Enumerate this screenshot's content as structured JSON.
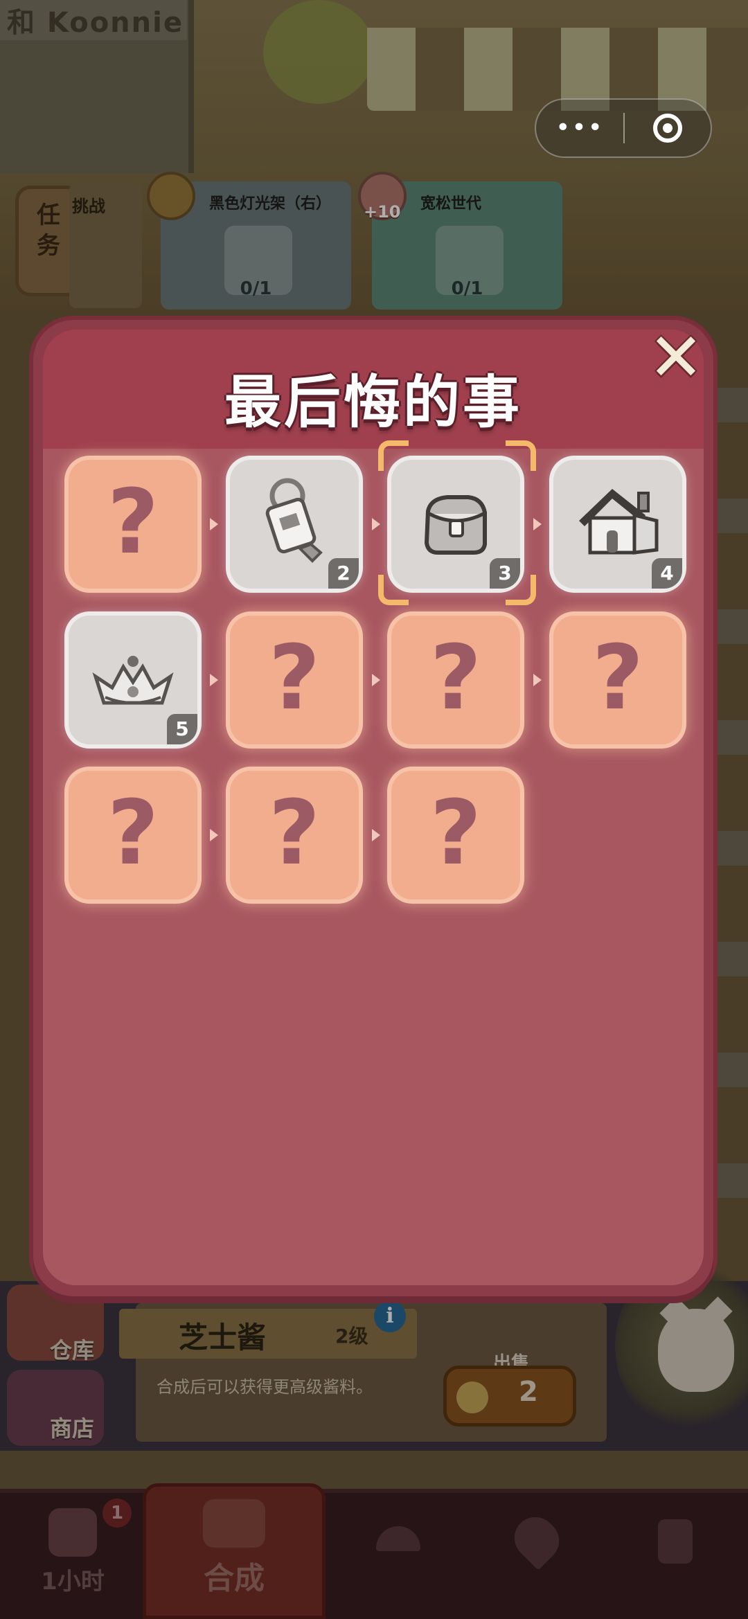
{
  "background": {
    "shop_sign": "和 Koonnie",
    "task_button": "任\n务",
    "challenge_label": "挑战",
    "orders": [
      {
        "title": "黑色灯光架（右）",
        "count": "0/1",
        "icon": "hammer-icon"
      },
      {
        "title": "宽松世代",
        "count": "0/1",
        "bonus": "+10",
        "icon": "shirt-icon"
      }
    ]
  },
  "modal": {
    "title": "最后悔的事",
    "close_glyph": "✕",
    "slots": [
      {
        "state": "unknown",
        "glyph": "?"
      },
      {
        "state": "known",
        "icon": "tag-icon",
        "level": "2"
      },
      {
        "state": "known",
        "icon": "bag-icon",
        "level": "3",
        "selected": true
      },
      {
        "state": "known",
        "icon": "house-icon",
        "level": "4"
      },
      {
        "state": "known",
        "icon": "crown-icon",
        "level": "5"
      },
      {
        "state": "unknown",
        "glyph": "?"
      },
      {
        "state": "unknown",
        "glyph": "?"
      },
      {
        "state": "unknown",
        "glyph": "?"
      },
      {
        "state": "unknown",
        "glyph": "?"
      },
      {
        "state": "unknown",
        "glyph": "?"
      },
      {
        "state": "unknown",
        "glyph": "?"
      }
    ]
  },
  "item_info": {
    "name": "芝士酱",
    "level": "2级",
    "info_glyph": "i",
    "description": "合成后可以获得更高级酱料。",
    "sell_label": "出售",
    "sell_price": "2"
  },
  "side_buttons": {
    "warehouse": "仓库",
    "shop": "商店"
  },
  "bottom_nav": {
    "timer_label": "1小时",
    "timer_badge": "1",
    "merge_label": "合成"
  },
  "capsule": {
    "more_glyph": "•••"
  }
}
